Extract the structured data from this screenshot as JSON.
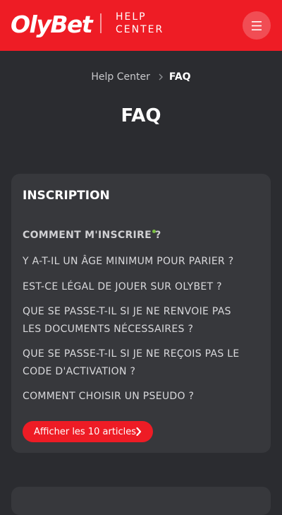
{
  "header": {
    "logo_text": "OlyBet",
    "help_line1": "HELP",
    "help_line2": "CENTER",
    "menu_icon": "hamburger-icon",
    "brand_color": "#ee1c25"
  },
  "breadcrumb": {
    "home": "Help Center",
    "current": "FAQ"
  },
  "page": {
    "title": "FAQ"
  },
  "section": {
    "title": "INSCRIPTION",
    "questions": [
      "COMMENT M'INSCRIRE ?",
      "Y A-T-IL UN ÂGE MINIMUM POUR PARIER ?",
      "EST-CE LÉGAL DE JOUER SUR OLYBET ?",
      "QUE SE PASSE-T-IL SI JE NE RENVOIE PAS LES DOCUMENTS NÉCESSAIRES ?",
      "QUE SE PASSE-T-IL SI JE NE REÇOIS PAS LE CODE D'ACTIVATION ?",
      "COMMENT CHOISIR UN PSEUDO ?"
    ],
    "show_all_label": "Afficher les 10 articles",
    "active_dot_color": "#7cc242"
  }
}
